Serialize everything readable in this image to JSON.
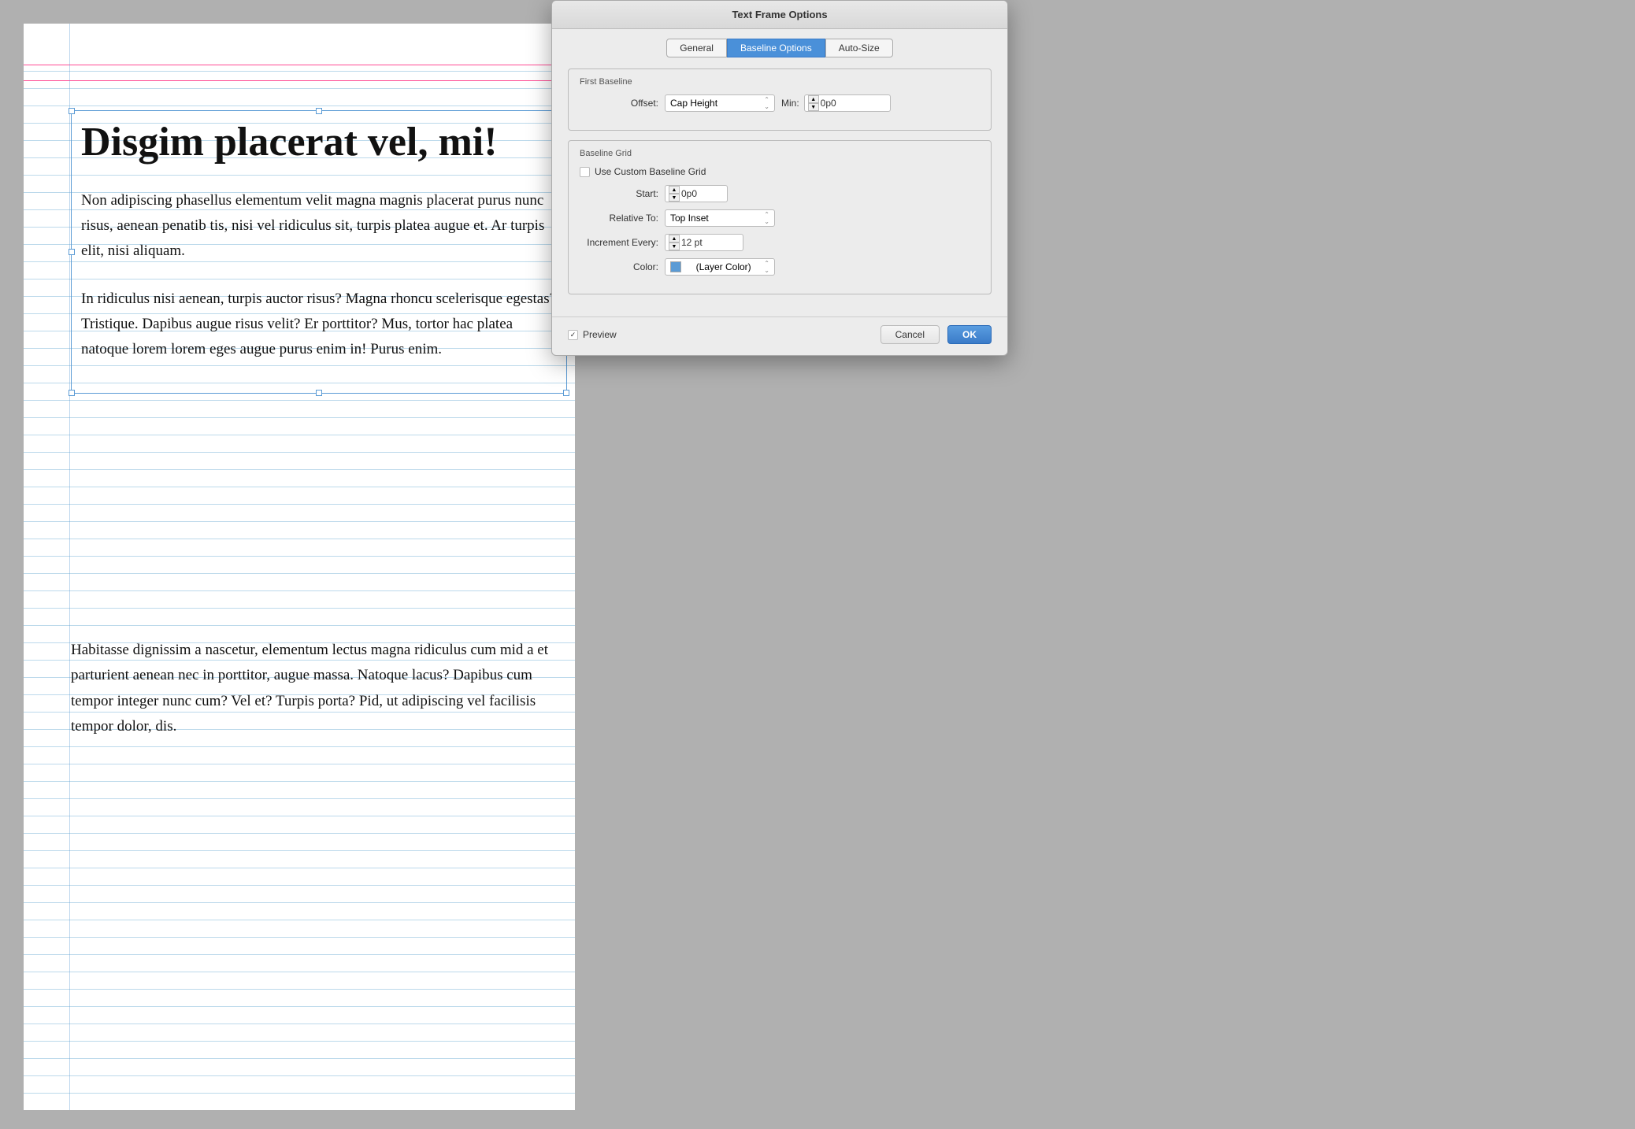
{
  "document": {
    "background_color": "#b4b4b4"
  },
  "page": {
    "heading": "Disgim placerat vel, mi!",
    "paragraph1": "Non adipiscing phasellus elementum velit magna magnis placerat purus nunc risus, aenean penatib tis, nisi vel ridiculus sit, turpis platea augue et. Ar turpis elit, nisi aliquam.",
    "paragraph2": "In ridiculus nisi aenean, turpis auctor risus? Magna rhoncu scelerisque egestas? Tristique. Dapibus augue risus velit? Er porttitor? Mus, tortor hac platea natoque lorem lorem eges augue purus enim in! Purus enim.",
    "paragraph3": "Habitasse dignissim a nascetur, elementum lectus magna ridiculus cum mid a et parturient aenean nec in porttitor, augue massa. Natoque lacus? Dapibus cum tempor integer nunc cum? Vel et? Turpis porta? Pid, ut adipiscing vel facilisis tempor dolor, dis."
  },
  "dialog": {
    "title": "Text Frame Options",
    "tabs": [
      {
        "label": "General",
        "active": false
      },
      {
        "label": "Baseline Options",
        "active": true
      },
      {
        "label": "Auto-Size",
        "active": false
      }
    ],
    "first_baseline": {
      "legend": "First Baseline",
      "offset_label": "Offset:",
      "offset_value": "Cap Height",
      "min_label": "Min:",
      "min_value": "0p0"
    },
    "baseline_grid": {
      "legend": "Baseline Grid",
      "checkbox_label": "Use Custom Baseline Grid",
      "checkbox_checked": false,
      "start_label": "Start:",
      "start_value": "0p0",
      "relative_to_label": "Relative To:",
      "relative_to_value": "Top Inset",
      "increment_label": "Increment Every:",
      "increment_value": "12 pt",
      "color_label": "Color:",
      "color_value": "(Layer Color)"
    },
    "footer": {
      "preview_label": "Preview",
      "preview_checked": true,
      "cancel_label": "Cancel",
      "ok_label": "OK"
    }
  }
}
